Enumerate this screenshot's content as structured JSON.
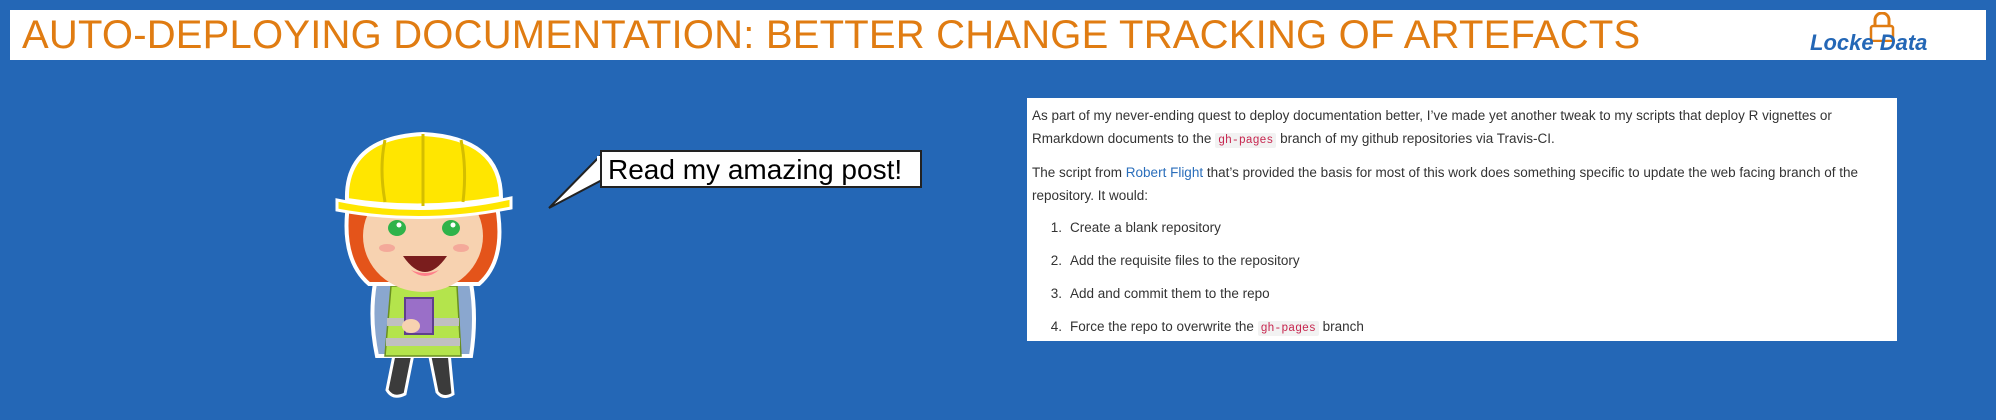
{
  "header": {
    "title": "AUTO-DEPLOYING DOCUMENTATION: BETTER CHANGE TRACKING OF ARTEFACTS",
    "logo_text": "Locke Data"
  },
  "illustration": {
    "character": "builder-girl-illustration",
    "speech_bubble": "Read my amazing post!"
  },
  "post": {
    "paragraph1": {
      "before": "As part of my never-ending quest to deploy documentation better, I’ve made yet another tweak to my scripts that deploy R vignettes or Rmarkdown documents to the",
      "code": "gh-pages",
      "after": "branch of my github repositories via Travis-CI."
    },
    "paragraph2": {
      "before": "The script from",
      "link": "Robert Flight",
      "after": "that’s provided the basis for most of this work does something specific to update the web facing branch of the repository. It would:"
    },
    "steps": [
      {
        "num": "1.",
        "text": "Create a blank repository"
      },
      {
        "num": "2.",
        "text": "Add the requisite files to the repository"
      },
      {
        "num": "3.",
        "text": "Add and commit them to the repo"
      },
      {
        "num": "4.",
        "text_before": "Force the repo to overwrite the",
        "code": "gh-pages",
        "text_after": "branch"
      }
    ]
  },
  "colors": {
    "background": "#2467b6",
    "title": "#e07c12",
    "link": "#2a6ebb",
    "code": "#c7254e"
  }
}
